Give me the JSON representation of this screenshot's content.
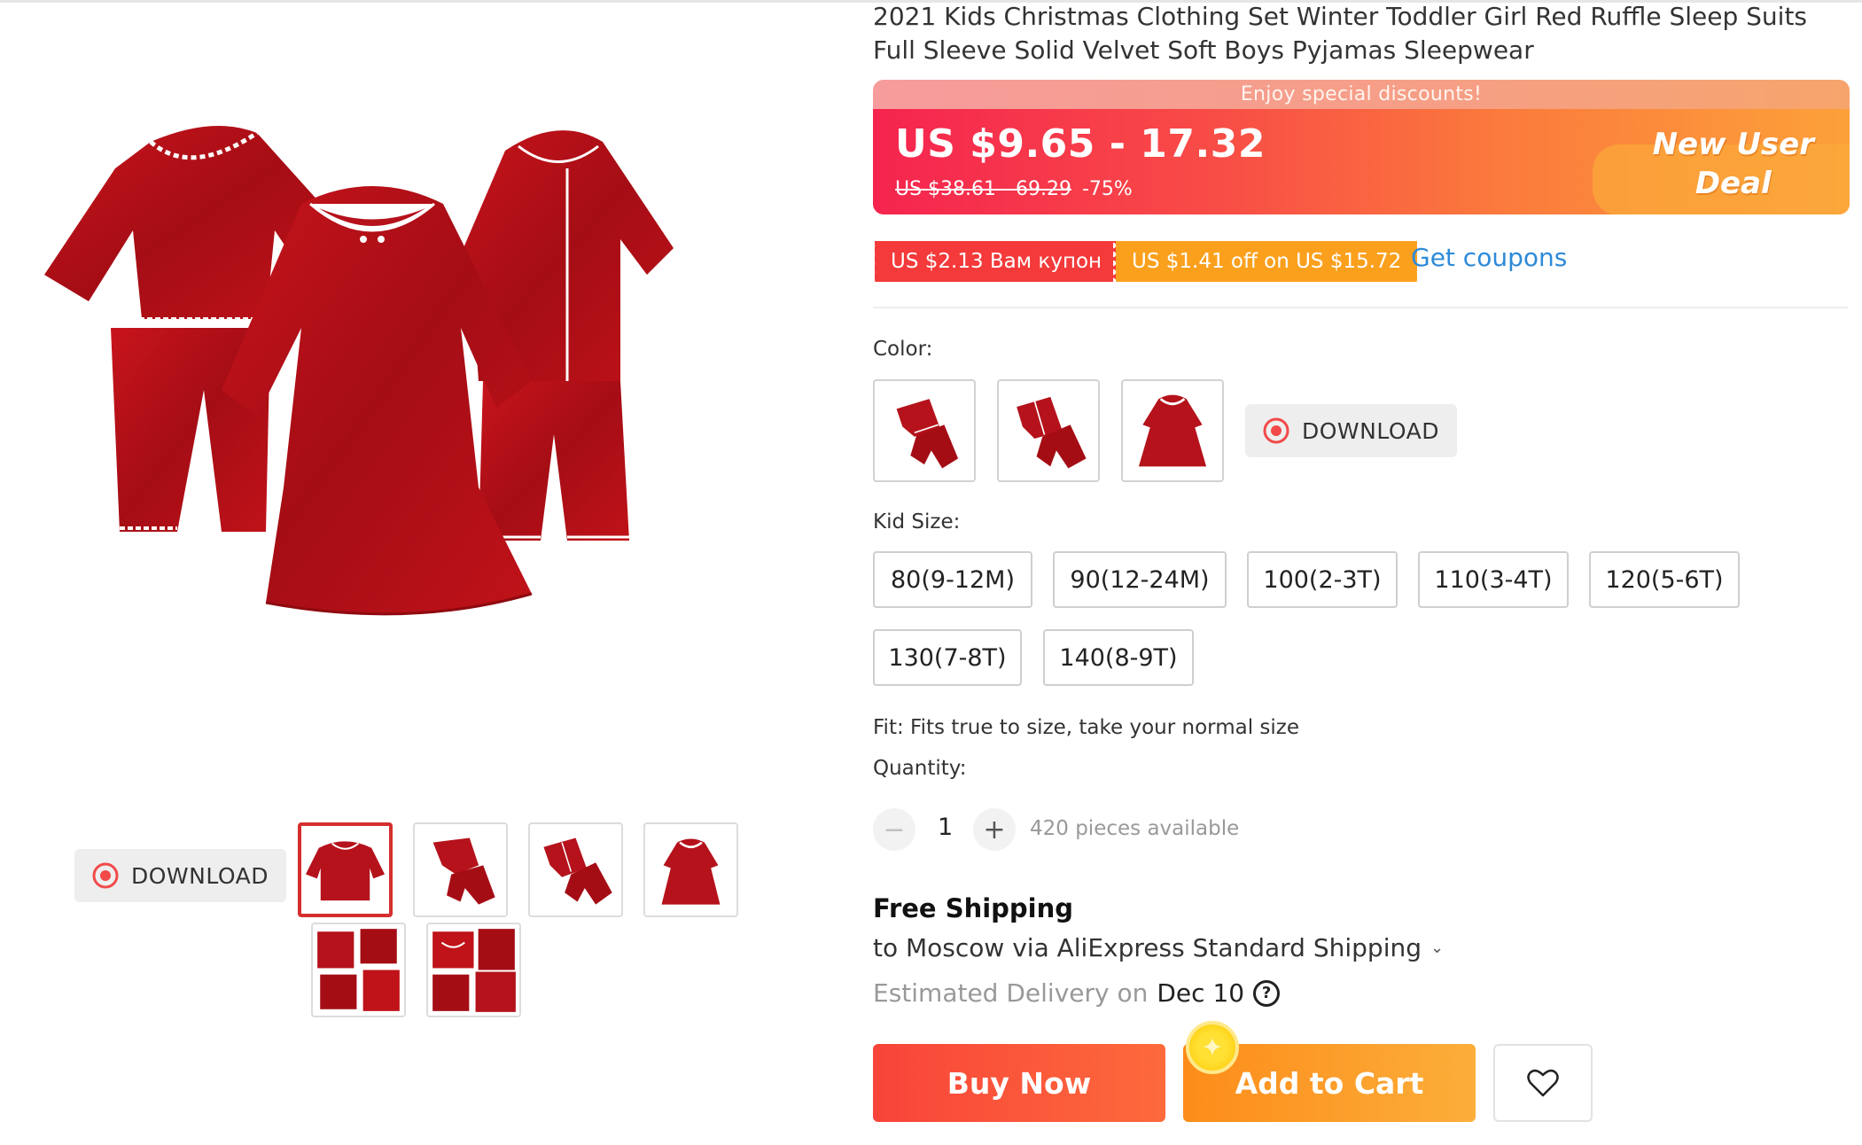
{
  "product": {
    "title": "2021 Kids Christmas Clothing Set Winter Toddler Girl Red Ruffle Sleep Suits Full Sleeve Solid Velvet Soft Boys Pyjamas Sleepwear"
  },
  "gallery": {
    "main_image": "red-velvet-pajamas-and-dress",
    "download_label": "DOWNLOAD",
    "thumbnails": [
      {
        "name": "girl-pajama-set",
        "active": true
      },
      {
        "name": "pajama-set-flat"
      },
      {
        "name": "boy-pajama-set"
      },
      {
        "name": "red-dress"
      },
      {
        "name": "detail-collage-1"
      },
      {
        "name": "detail-collage-2"
      }
    ]
  },
  "price": {
    "promo_strip": "Enjoy special discounts!",
    "current": "US $9.65 - 17.32",
    "original": "US $38.61 - 69.29",
    "discount": "-75%",
    "deal_line1": "New User",
    "deal_line2": "Deal"
  },
  "coupons": {
    "coupon1": "US $2.13 Вам купон",
    "coupon2": "US $1.41 off on US $15.72",
    "get_coupons": "Get coupons"
  },
  "color": {
    "label": "Color:",
    "download_label": "DOWNLOAD",
    "options": [
      "girl-pajama-set",
      "boy-pajama-set",
      "red-dress"
    ]
  },
  "size": {
    "label": "Kid Size:",
    "options": [
      "80(9-12M)",
      "90(12-24M)",
      "100(2-3T)",
      "110(3-4T)",
      "120(5-6T)",
      "130(7-8T)",
      "140(8-9T)"
    ]
  },
  "fit": "Fit: Fits true to size, take your normal size",
  "quantity": {
    "label": "Quantity:",
    "minus": "−",
    "value": "1",
    "plus": "+",
    "available": "420 pieces available"
  },
  "shipping": {
    "title": "Free Shipping",
    "line": "to Moscow via AliExpress Standard Shipping",
    "chevron": "⌄",
    "estimated_label": "Estimated Delivery on",
    "date": "Dec 10",
    "help": "?"
  },
  "actions": {
    "buy_now": "Buy Now",
    "add_to_cart": "Add to Cart",
    "coin": "✦"
  },
  "colors": {
    "velvet_red": "#b5121b",
    "price_gradient_start": "#f5244f",
    "price_gradient_end": "#fca13a",
    "link_blue": "#2e8ad8",
    "buy_red": "#f8443a",
    "cart_orange": "#fd8c1a"
  }
}
